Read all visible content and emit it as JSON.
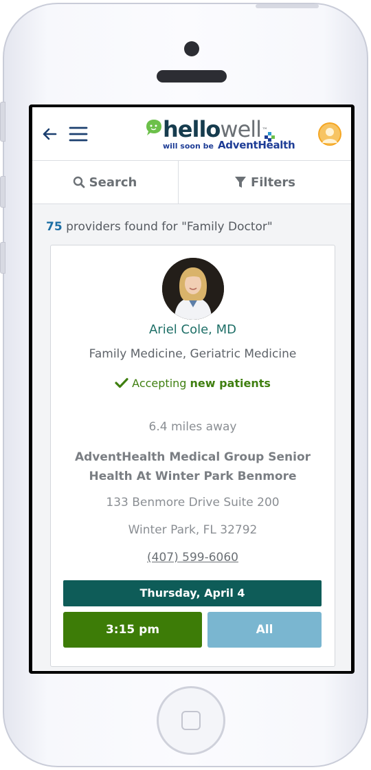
{
  "header": {
    "logo_hello": "hello",
    "logo_well": "well",
    "logo_tm": "™",
    "logo_tagline": "will soon be",
    "logo_brand": "AdventHealth"
  },
  "toolbar": {
    "search_label": "Search",
    "filters_label": "Filters"
  },
  "results": {
    "count": "75",
    "text": " providers found for \"Family Doctor\""
  },
  "provider": {
    "name": "Ariel Cole, MD",
    "specialty": "Family Medicine, Geriatric Medicine",
    "accepting_prefix": "Accepting ",
    "accepting_bold": "new patients",
    "distance": "6.4 miles away",
    "location_line1": "AdventHealth Medical Group Senior",
    "location_line2": "Health At Winter Park Benmore",
    "address_line1": "133 Benmore Drive Suite 200",
    "address_line2": "Winter Park, FL 32792",
    "phone": "(407) 599-6060"
  },
  "appointments": {
    "date": "Thursday, April 4",
    "slot": "3:15 pm",
    "all_label": "All"
  },
  "colors": {
    "brand_teal": "#0e5c58",
    "slot_green": "#3d7c07",
    "all_blue": "#7ab6d0",
    "accept_green": "#3f7f10",
    "count_blue": "#1d6fa5"
  },
  "icons": [
    "back-arrow-icon",
    "hamburger-menu-icon",
    "speech-bubble-icon",
    "user-avatar-icon",
    "search-icon",
    "filter-icon",
    "checkmark-icon"
  ]
}
